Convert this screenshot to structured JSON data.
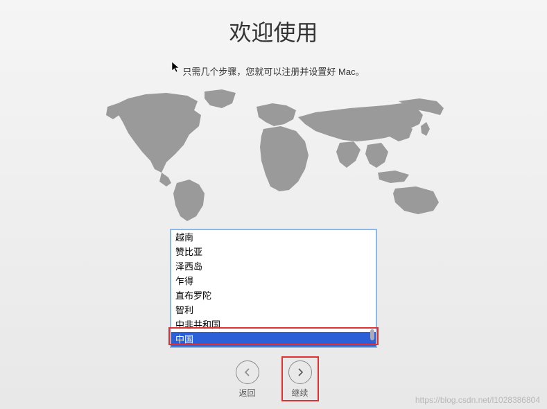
{
  "title": "欢迎使用",
  "subtitle": "只需几个步骤，您就可以注册并设置好 Mac。",
  "countries": {
    "items": [
      {
        "label": "越南",
        "selected": false
      },
      {
        "label": "赞比亚",
        "selected": false
      },
      {
        "label": "泽西岛",
        "selected": false
      },
      {
        "label": "乍得",
        "selected": false
      },
      {
        "label": "直布罗陀",
        "selected": false
      },
      {
        "label": "智利",
        "selected": false
      },
      {
        "label": "中非共和国",
        "selected": false
      },
      {
        "label": "中国",
        "selected": true
      }
    ]
  },
  "nav": {
    "back": "返回",
    "continue": "继续"
  },
  "watermark": "https://blog.csdn.net/l1028386804"
}
